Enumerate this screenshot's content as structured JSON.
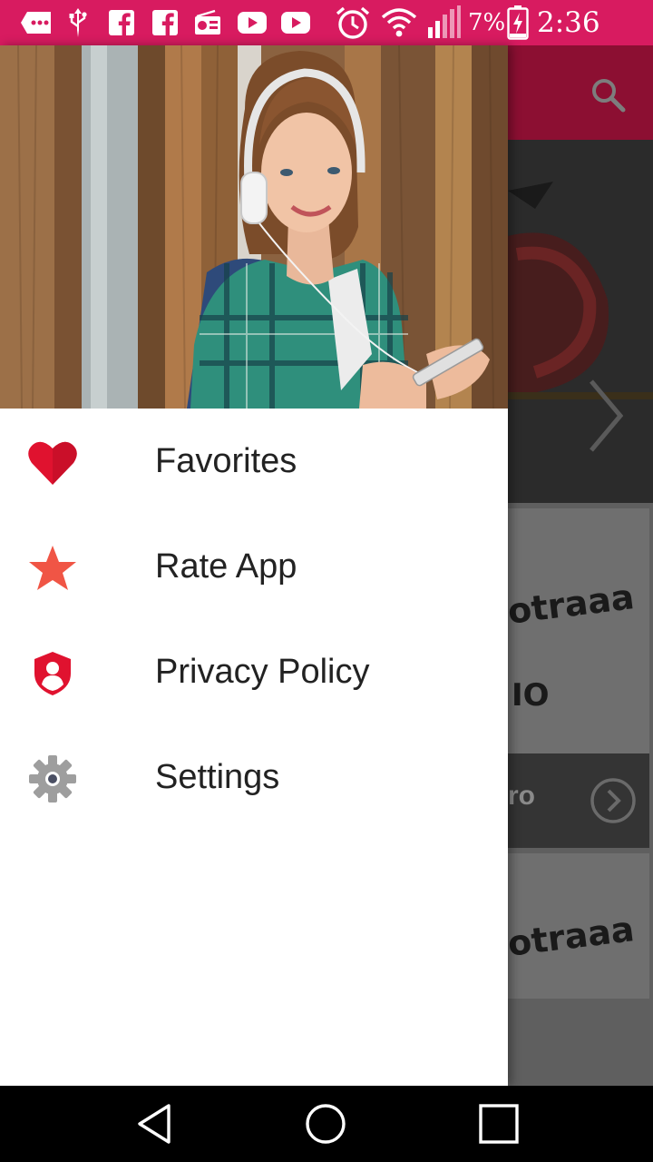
{
  "status_bar": {
    "icons": [
      "message-icon",
      "usb-icon",
      "facebook-icon",
      "facebook-icon",
      "radio-icon",
      "youtube-icon",
      "youtube-icon",
      "alarm-icon",
      "wifi-icon",
      "signal-icon",
      "battery-charging-icon"
    ],
    "battery": "7%",
    "time": "2:36 PM",
    "background_color": "#d81b60"
  },
  "background_app": {
    "toolbar_color": "#8c0f32",
    "search_icon": "search-icon",
    "card_logo_text": "otraaa",
    "card_logo_sub": "IO",
    "card_button_text": "ro"
  },
  "drawer": {
    "header_image": "girl-with-headphones-photo",
    "menu": [
      {
        "id": "favorites",
        "label": "Favorites",
        "icon": "heart-icon",
        "icon_color": "#e0122f"
      },
      {
        "id": "rate-app",
        "label": "Rate App",
        "icon": "star-icon",
        "icon_color": "#f05545"
      },
      {
        "id": "privacy-policy",
        "label": "Privacy Policy",
        "icon": "shield-user-icon",
        "icon_color": "#e0122f"
      },
      {
        "id": "settings",
        "label": "Settings",
        "icon": "gear-icon",
        "icon_color": "#9e9e9e"
      }
    ]
  },
  "nav_bar": {
    "back": "back-icon",
    "home": "home-icon",
    "recents": "recents-icon"
  }
}
